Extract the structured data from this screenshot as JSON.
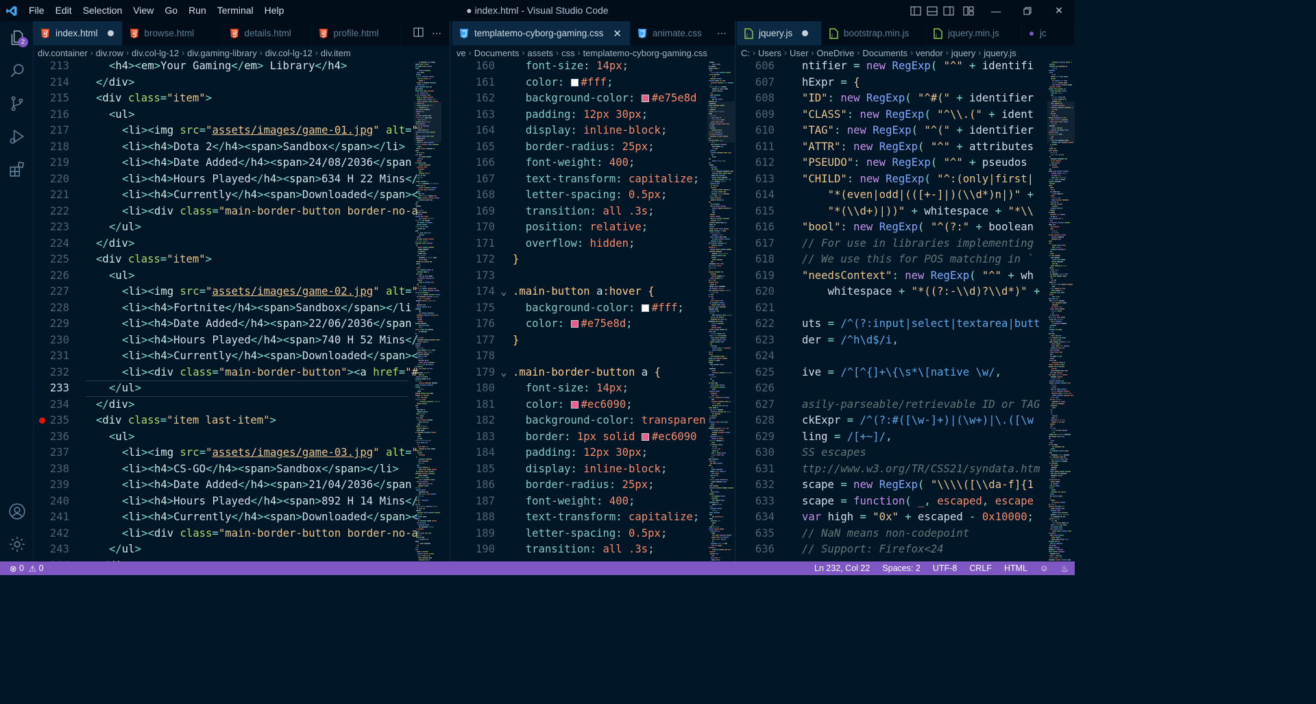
{
  "titlebar": {
    "menu": [
      "File",
      "Edit",
      "Selection",
      "View",
      "Go",
      "Run",
      "Terminal",
      "Help"
    ],
    "title": "● index.html - Visual Studio Code"
  },
  "activity": {
    "explorer_badge": "2"
  },
  "group1": {
    "tabs": [
      {
        "label": "index.html",
        "type": "html",
        "active": true,
        "dirty": true
      },
      {
        "label": "browse.html",
        "type": "html"
      },
      {
        "label": "details.html",
        "type": "html"
      },
      {
        "label": "profile.html",
        "type": "html"
      }
    ],
    "breadcrumbs": [
      "div.container",
      "div.row",
      "div.col-lg-12",
      "div.gaming-library",
      "div.col-lg-12",
      "div.item"
    ]
  },
  "group2": {
    "tabs": [
      {
        "label": "templatemo-cyborg-gaming.css",
        "type": "css",
        "active": true
      },
      {
        "label": "animate.css",
        "type": "css"
      }
    ],
    "breadcrumbs": [
      "ve",
      "Documents",
      "assets",
      "css",
      "templatemo-cyborg-gaming.css"
    ]
  },
  "group3": {
    "tabs": [
      {
        "label": "jquery.js",
        "type": "js",
        "active": true,
        "dirty": true
      },
      {
        "label": "bootstrap.min.js",
        "type": "js"
      },
      {
        "label": "jquery.min.js",
        "type": "js"
      },
      {
        "label": "jc",
        "type": "js"
      }
    ],
    "breadcrumbs": [
      "C:",
      "Users",
      "User",
      "OneDrive",
      "Documents",
      "vendor",
      "jquery",
      "jquery.js"
    ]
  },
  "colors": {
    "accent": "#7e57c2",
    "pink": "#e75e8d",
    "pink2": "#ec6090",
    "white": "#ffffff"
  },
  "status": {
    "errors": "0",
    "warnings": "0",
    "position": "Ln 232, Col 22",
    "spaces": "Spaces: 2",
    "encoding": "UTF-8",
    "eol": "CRLF",
    "language": "HTML"
  }
}
